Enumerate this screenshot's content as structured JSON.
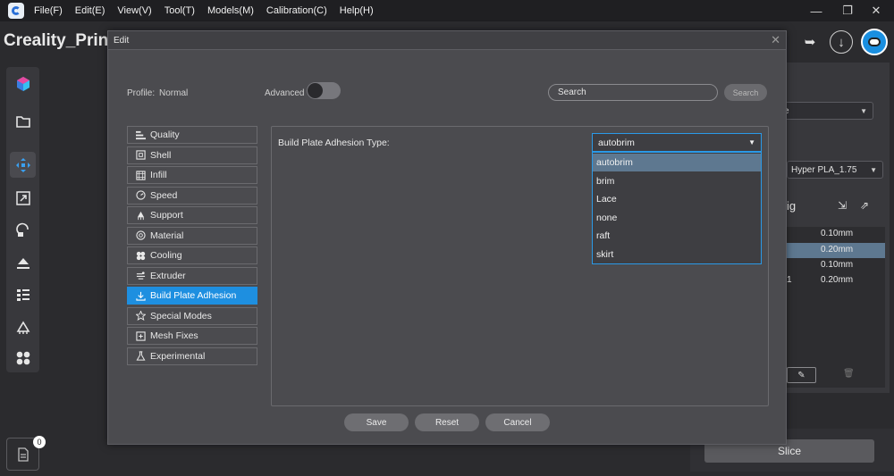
{
  "menubar": {
    "items": [
      "File(F)",
      "Edit(E)",
      "View(V)",
      "Tool(T)",
      "Models(M)",
      "Calibration(C)",
      "Help(H)"
    ]
  },
  "app": {
    "title": "Creality_Prin"
  },
  "right_panel": {
    "select_fragment": "e",
    "filament": "Hyper PLA_1.75",
    "heading_fragment": "ig",
    "rows": [
      {
        "lead": "",
        "value": "0.10mm"
      },
      {
        "lead": "",
        "value": "0.20mm"
      },
      {
        "lead": "",
        "value": "0.10mm"
      },
      {
        "lead": "1",
        "value": "0.20mm"
      }
    ]
  },
  "slice_label": "Slice",
  "file_badge": "0",
  "dialog": {
    "title": "Edit",
    "profile_label": "Profile:",
    "profile_value": "Normal",
    "advanced_label": "Advanced",
    "advanced_on": false,
    "search_placeholder": "Search",
    "search_button": "Search",
    "categories": [
      {
        "label": "Quality",
        "icon": "quality-icon"
      },
      {
        "label": "Shell",
        "icon": "shell-icon"
      },
      {
        "label": "Infill",
        "icon": "infill-icon"
      },
      {
        "label": "Speed",
        "icon": "speed-icon"
      },
      {
        "label": "Support",
        "icon": "support-icon"
      },
      {
        "label": "Material",
        "icon": "material-icon"
      },
      {
        "label": "Cooling",
        "icon": "fan-icon"
      },
      {
        "label": "Extruder",
        "icon": "extruder-icon"
      },
      {
        "label": "Build Plate Adhesion",
        "icon": "adhesion-icon"
      },
      {
        "label": "Special Modes",
        "icon": "star-icon"
      },
      {
        "label": "Mesh Fixes",
        "icon": "plus-box-icon"
      },
      {
        "label": "Experimental",
        "icon": "flask-icon"
      }
    ],
    "active_category": "Build Plate Adhesion",
    "setting": {
      "label": "Build Plate Adhesion Type:",
      "value": "autobrim",
      "options": [
        "autobrim",
        "brim",
        "Lace",
        "none",
        "raft",
        "skirt"
      ]
    },
    "buttons": {
      "save": "Save",
      "reset": "Reset",
      "cancel": "Cancel"
    }
  },
  "colors": {
    "accent": "#1e8fe0",
    "dialog_bg": "#4b4b4f",
    "app_bg": "#2b2b2e"
  }
}
